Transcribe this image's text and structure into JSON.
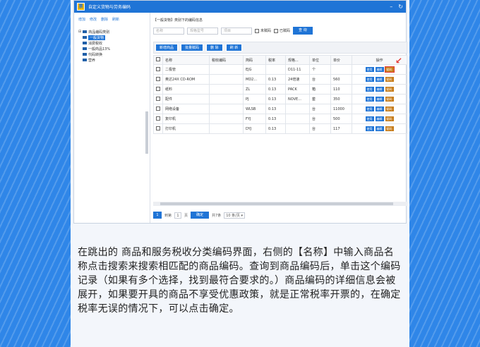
{
  "window": {
    "title": "自定义货物与劳务编码",
    "controls": [
      "–",
      "↻"
    ]
  },
  "left_menu": [
    "增加",
    "修改",
    "删除",
    "刷新"
  ],
  "tree": [
    {
      "label": "商品编码类别",
      "level": 0,
      "selected": false
    },
    {
      "label": "一般货物",
      "level": 1,
      "selected": true
    },
    {
      "label": "消费税收",
      "level": 1,
      "selected": false
    },
    {
      "label": "一般商品13%",
      "level": 1,
      "selected": false
    },
    {
      "label": "代码转换",
      "level": 1,
      "selected": false
    },
    {
      "label": "营养",
      "level": 0,
      "selected": false
    }
  ],
  "breadcrumb": "【一般货物】类别下的编码信息",
  "search": {
    "name_placeholder": "名称",
    "spec_placeholder": "规格型号",
    "item_placeholder": "项目",
    "check1": "未赋码",
    "check2": "已赋码",
    "button": "查 询"
  },
  "toolbar": [
    "新增商品",
    "批量赋码",
    "删 除",
    "刷 新"
  ],
  "table": {
    "headers": [
      "",
      "名称",
      "税收编码",
      "简码",
      "税率",
      "规格...",
      "单位",
      "单价",
      "操作"
    ],
    "rows": [
      {
        "name": "二极管",
        "code": "",
        "short": "EJG",
        "rate": "",
        "spec": "D11-11",
        "unit": "个",
        "price": ""
      },
      {
        "name": "奥达24X CD-ROM",
        "code": "",
        "short": "MD2...",
        "rate": "0.13",
        "spec": "24倍速",
        "unit": "台",
        "price": "560"
      },
      {
        "name": "纸料",
        "code": "",
        "short": "ZL",
        "rate": "0.13",
        "spec": "PACK",
        "unit": "箱",
        "price": "110"
      },
      {
        "name": "配件",
        "code": "",
        "short": "PJ",
        "rate": "0.13",
        "spec": "NOVE...",
        "unit": "套",
        "price": "350"
      },
      {
        "name": "网络设备",
        "code": "",
        "short": "WLSB",
        "rate": "0.13",
        "spec": "",
        "unit": "台",
        "price": "11000"
      },
      {
        "name": "复印机",
        "code": "",
        "short": "FYJ",
        "rate": "0.13",
        "spec": "",
        "unit": "台",
        "price": "500"
      },
      {
        "name": "打印机",
        "code": "",
        "short": "DYJ",
        "rate": "0.13",
        "spec": "",
        "unit": "台",
        "price": "117"
      }
    ],
    "ops": [
      "使用",
      "编辑",
      "赋码"
    ]
  },
  "pager": {
    "page": "1",
    "prefix": "到第",
    "suffix": "页",
    "go": "确定",
    "total": "共7条",
    "per_page": "10 条/页"
  },
  "caption": "在跳出的 商品和服务税收分类编码界面，右侧的【名称】中输入商品名称点击搜索来搜索相匹配的商品编码。查询到商品编码后，单击这个编码记录（如果有多个选择，找到最符合要求的。）商品编码的详细信息会被展开，如果要开具的商品不享受优惠政策，就是正常税率开票的，在确定税率无误的情况下，可以点击确定。",
  "colors": {
    "accent": "#1f74d6",
    "encode": "#c77d1b",
    "highlight": "#e53935",
    "background": "#2f86e8"
  }
}
